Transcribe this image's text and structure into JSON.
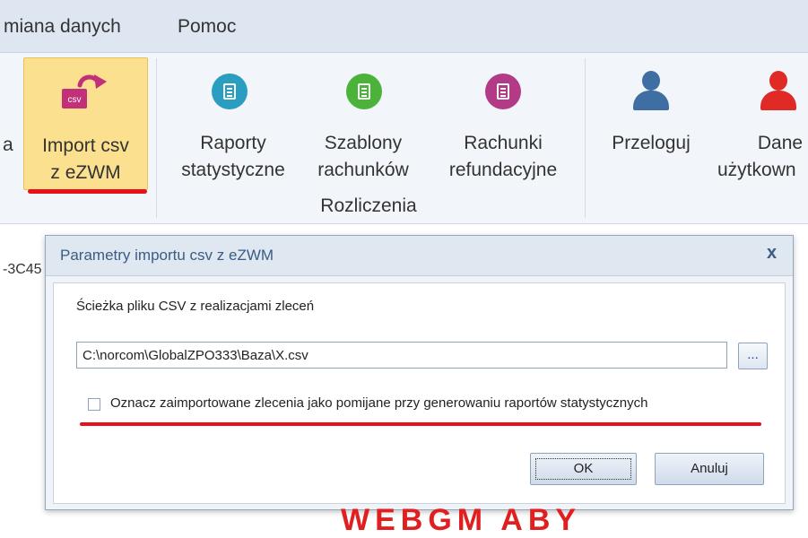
{
  "menu": {
    "items": [
      {
        "label": "miana danych"
      },
      {
        "label": "Pomoc"
      }
    ]
  },
  "ribbon": {
    "edge_fragment": "a",
    "import_button": {
      "line1": "Import csv",
      "line2": "z eZWM",
      "icon_text": "csv"
    },
    "reports_button": {
      "line1": "Raporty",
      "line2": "statystyczne"
    },
    "templates_button": {
      "line1": "Szablony",
      "line2": "rachunków"
    },
    "bills_button": {
      "line1": "Rachunki",
      "line2": "refundacyjne"
    },
    "group_label": "Rozliczenia",
    "relogin_button": {
      "line1": "Przeloguj"
    },
    "user_data_button": {
      "line1": "Dane",
      "line2": "użytkown"
    }
  },
  "workspace": {
    "side_text": "-3C45"
  },
  "dialog": {
    "title": "Parametry importu csv z eZWM",
    "close_label": "x",
    "path_label": "Ścieżka pliku CSV z realizacjami zleceń",
    "path_value": "C:\\norcom\\GlobalZPO333\\Baza\\X.csv",
    "browse_label": "...",
    "checkbox_label": "Oznacz zaimportowane zlecenia jako pomijane przy generowaniu raportów statystycznych",
    "ok_label": "OK",
    "cancel_label": "Anuluj"
  },
  "watermark": "WEBGM ABY",
  "colors": {
    "reports_icon": "#2a9ec0",
    "templates_icon": "#4bb23a",
    "bills_icon": "#b23a86",
    "person_blue": "#3f6ea3",
    "person_red": "#e02a26",
    "csv_icon": "#c2307a",
    "highlight": "#e8101a"
  }
}
